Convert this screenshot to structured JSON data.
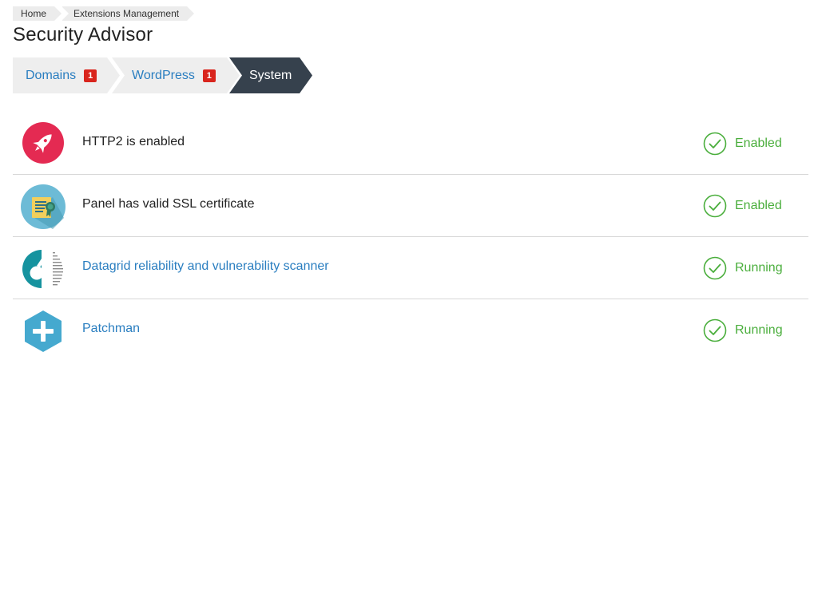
{
  "breadcrumb": {
    "items": [
      "Home",
      "Extensions Management"
    ]
  },
  "page": {
    "title": "Security Advisor"
  },
  "tabs": [
    {
      "label": "Domains",
      "badge": "1",
      "active": false
    },
    {
      "label": "WordPress",
      "badge": "1",
      "active": false
    },
    {
      "label": "System",
      "badge": null,
      "active": true
    }
  ],
  "checks": [
    {
      "title": "HTTP2 is enabled",
      "link": false,
      "icon": "rocket-icon",
      "status": "Enabled"
    },
    {
      "title": "Panel has valid SSL certificate",
      "link": false,
      "icon": "certificate-icon",
      "status": "Enabled"
    },
    {
      "title": "Datagrid reliability and vulnerability scanner",
      "link": true,
      "icon": "datagrid-logo-icon",
      "status": "Running"
    },
    {
      "title": "Patchman",
      "link": true,
      "icon": "patchman-plus-icon",
      "status": "Running"
    }
  ],
  "colors": {
    "link": "#2a7ec0",
    "status_ok": "#4aae3c",
    "badge": "#d9251d",
    "active_tab": "#36414d",
    "inactive_tab": "#eeeeee"
  }
}
